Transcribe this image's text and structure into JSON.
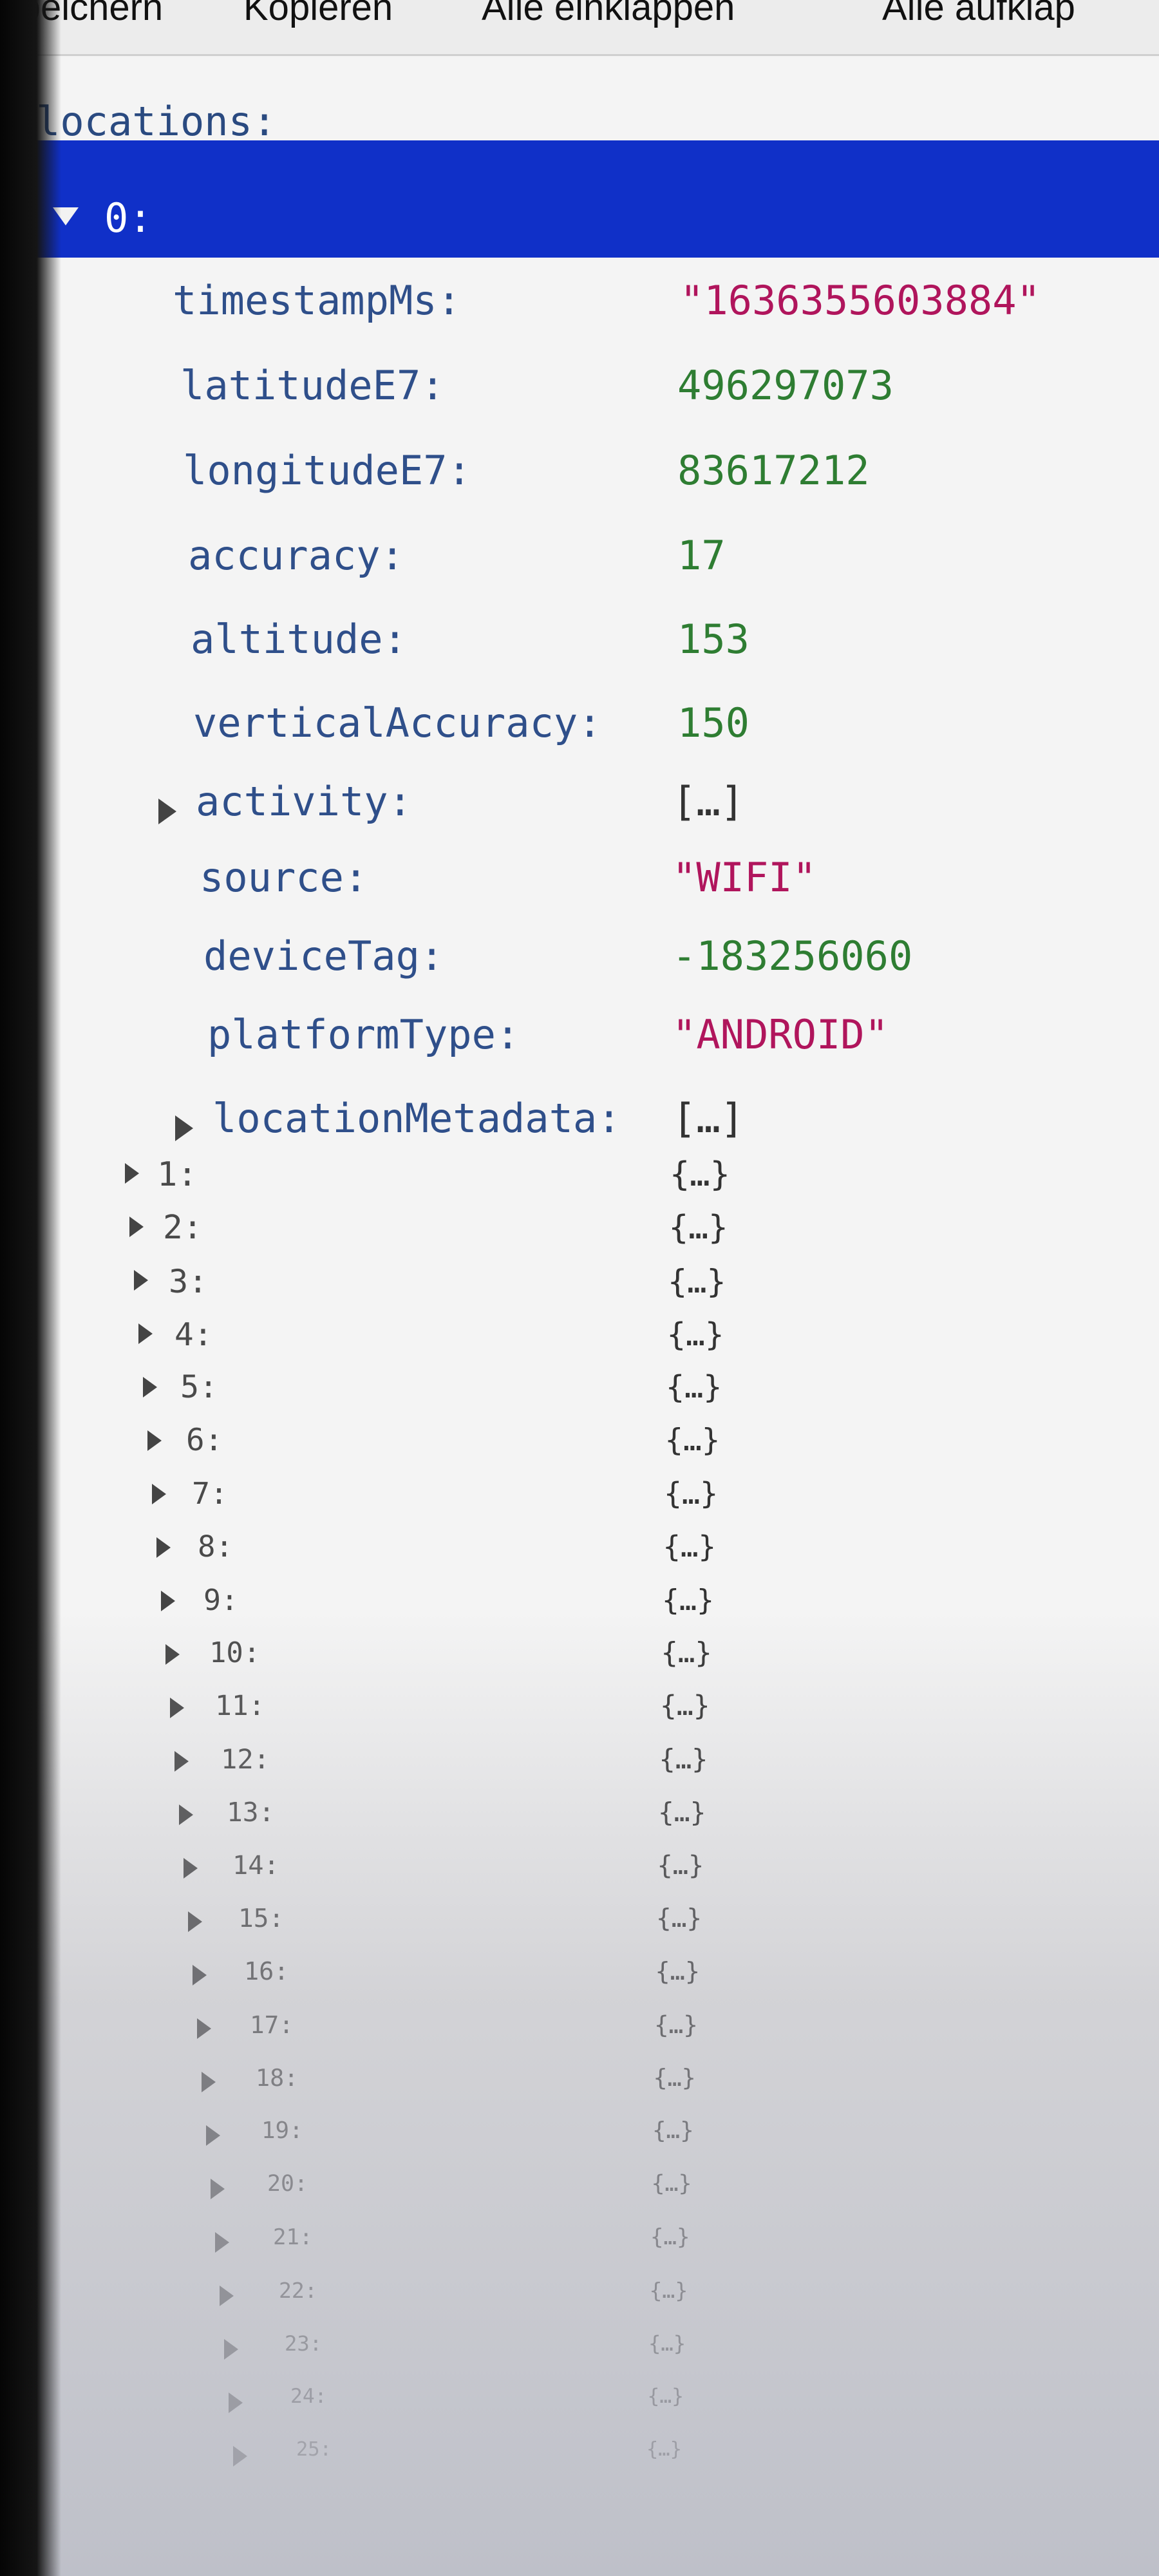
{
  "toolbar": {
    "save_label": "Speichern",
    "copy_label": "Kopieren",
    "collapse_all_label": "Alle einklappen",
    "expand_all_label": "Alle aufklap"
  },
  "tree": {
    "root_key": "locations:",
    "item0_key": "0:",
    "fields": [
      {
        "key": "timestampMs:",
        "value": "\"1636355603884\"",
        "type": "string"
      },
      {
        "key": "latitudeE7:",
        "value": "496297073",
        "type": "number"
      },
      {
        "key": "longitudeE7:",
        "value": "83617212",
        "type": "number"
      },
      {
        "key": "accuracy:",
        "value": "17",
        "type": "number"
      },
      {
        "key": "altitude:",
        "value": "153",
        "type": "number"
      },
      {
        "key": "verticalAccuracy:",
        "value": "150",
        "type": "number"
      },
      {
        "key": "activity:",
        "value": "[…]",
        "type": "array",
        "expandable": true
      },
      {
        "key": "source:",
        "value": "\"WIFI\"",
        "type": "string"
      },
      {
        "key": "deviceTag:",
        "value": "-183256060",
        "type": "number"
      },
      {
        "key": "platformType:",
        "value": "\"ANDROID\"",
        "type": "string"
      },
      {
        "key": "locationMetadata:",
        "value": "[…]",
        "type": "array",
        "expandable": true
      }
    ],
    "items": [
      {
        "key": "1:",
        "value": "{…}"
      },
      {
        "key": "2:",
        "value": "{…}"
      },
      {
        "key": "3:",
        "value": "{…}"
      },
      {
        "key": "4:",
        "value": "{…}"
      },
      {
        "key": "5:",
        "value": "{…}"
      },
      {
        "key": "6:",
        "value": "{…}"
      },
      {
        "key": "7:",
        "value": "{…}"
      },
      {
        "key": "8:",
        "value": "{…}"
      },
      {
        "key": "9:",
        "value": "{…}"
      },
      {
        "key": "10:",
        "value": "{…}"
      },
      {
        "key": "11:",
        "value": "{…}"
      },
      {
        "key": "12:",
        "value": "{…}"
      },
      {
        "key": "13:",
        "value": "{…}"
      },
      {
        "key": "14:",
        "value": "{…}"
      },
      {
        "key": "15:",
        "value": "{…}"
      },
      {
        "key": "16:",
        "value": "{…}"
      },
      {
        "key": "17:",
        "value": "{…}"
      },
      {
        "key": "18:",
        "value": "{…}"
      },
      {
        "key": "19:",
        "value": "{…}"
      },
      {
        "key": "20:",
        "value": "{…}"
      },
      {
        "key": "21:",
        "value": "{…}"
      },
      {
        "key": "22:",
        "value": "{…}"
      },
      {
        "key": "23:",
        "value": "{…}"
      },
      {
        "key": "24:",
        "value": "{…}"
      },
      {
        "key": "25:",
        "value": "{…}"
      }
    ]
  },
  "colors": {
    "selection": "#1030c8",
    "key": "#2f4f8a",
    "string": "#b0155c",
    "number": "#2e7d32"
  }
}
